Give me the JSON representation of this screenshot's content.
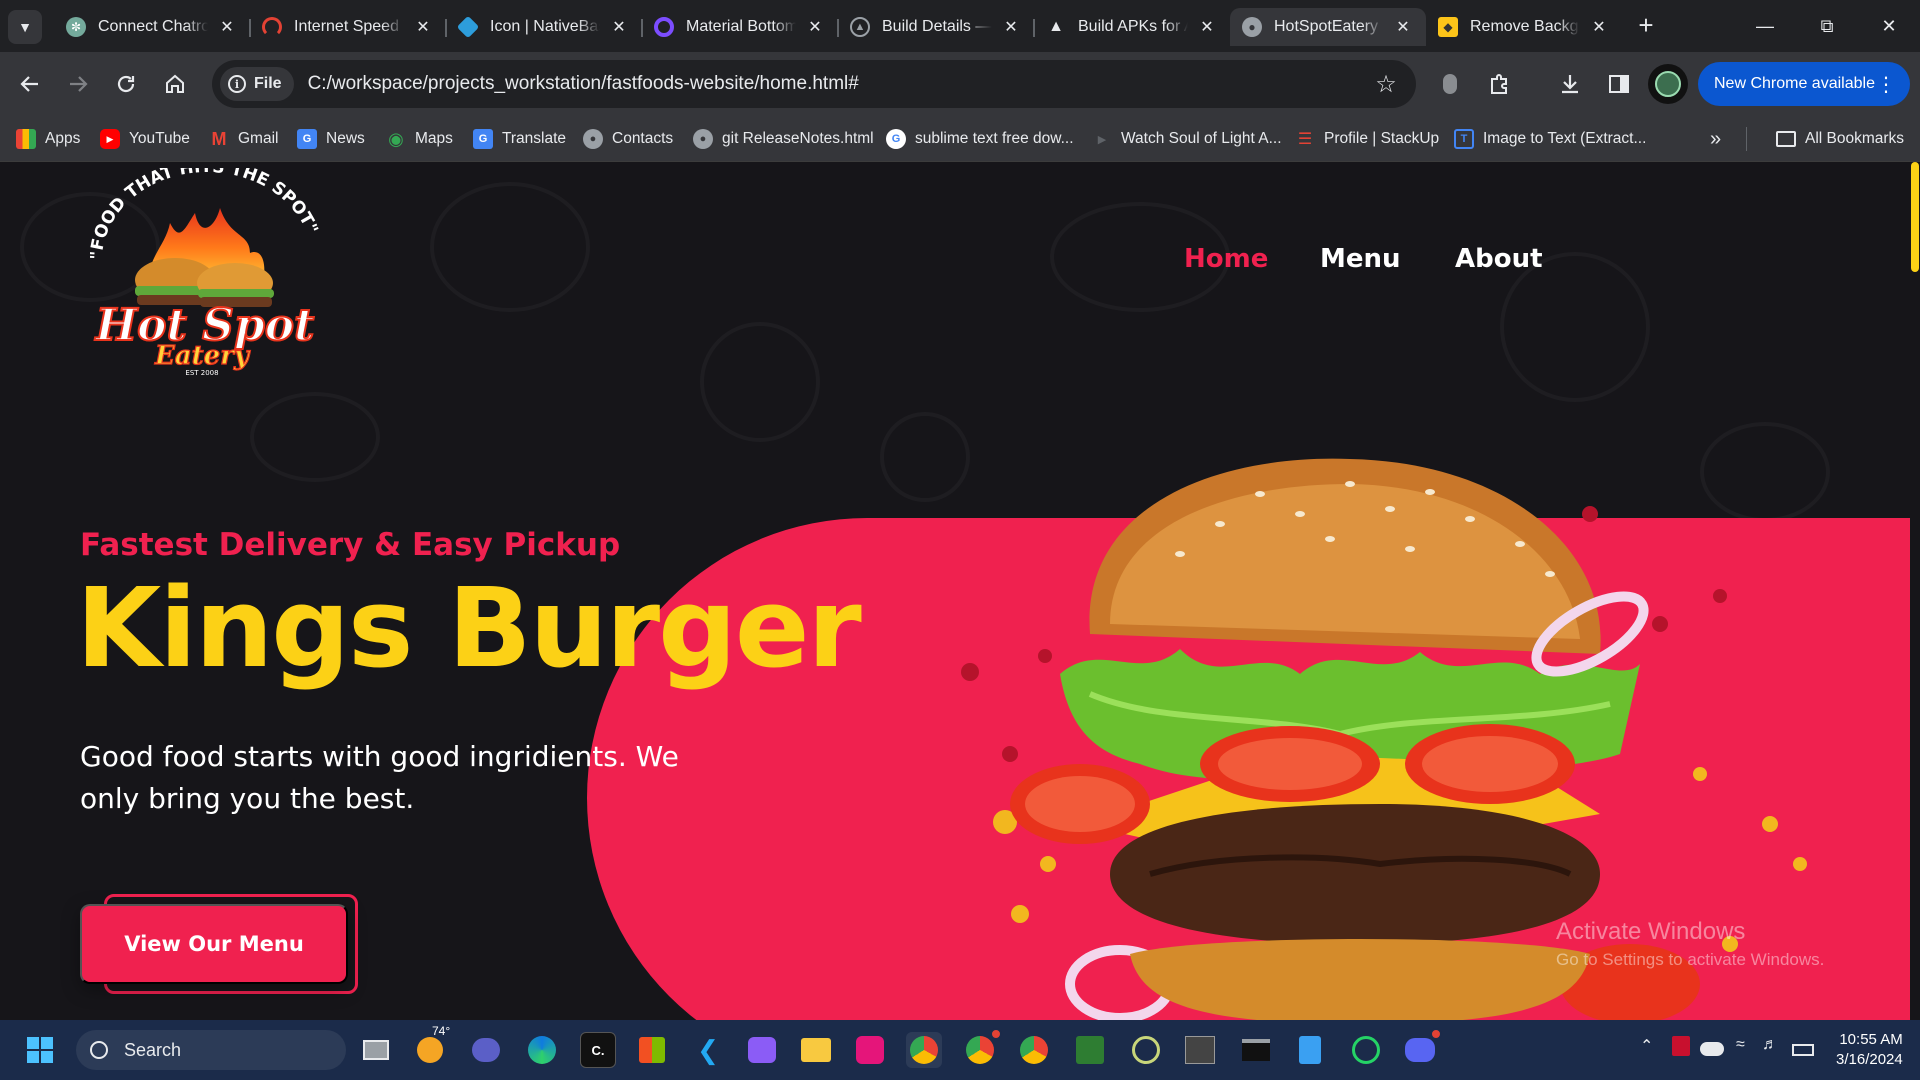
{
  "browser": {
    "tabs": [
      {
        "title": "Connect Chatroom",
        "icon": "chatgpt-icon",
        "color": "#74aa9c"
      },
      {
        "title": "Internet Speed Test",
        "icon": "speedtest-icon",
        "color": "#e34234"
      },
      {
        "title": "Icon | NativeBase",
        "icon": "nativebase-icon",
        "color": "#2d9ddb"
      },
      {
        "title": "Material Bottom Tabs",
        "icon": "material-icon",
        "color": "#7c4dff"
      },
      {
        "title": "Build Details — Expo",
        "icon": "expo-icon",
        "color": "#9aa0a6"
      },
      {
        "title": "Build APKs for Android",
        "icon": "expo-build-icon",
        "color": "#e8eaed"
      },
      {
        "title": "HotSpotEatery",
        "icon": "globe-icon",
        "color": "#9aa0a6",
        "active": true
      },
      {
        "title": "Remove Background",
        "icon": "remove-bg-icon",
        "color": "#fcc419"
      }
    ],
    "address_chip": "File",
    "url": "C:/workspace/projects_workstation/fastfoods-website/home.html#",
    "new_chrome_label": "New Chrome available",
    "bookmarks": [
      {
        "label": "Apps",
        "icon": "apps-grid-icon"
      },
      {
        "label": "YouTube",
        "icon": "youtube-icon"
      },
      {
        "label": "Gmail",
        "icon": "gmail-icon"
      },
      {
        "label": "News",
        "icon": "news-icon"
      },
      {
        "label": "Maps",
        "icon": "maps-icon"
      },
      {
        "label": "Translate",
        "icon": "translate-icon"
      },
      {
        "label": "Contacts",
        "icon": "globe-icon"
      },
      {
        "label": "git ReleaseNotes.html",
        "icon": "globe-icon"
      },
      {
        "label": "sublime text free dow...",
        "icon": "google-icon"
      },
      {
        "label": "Watch Soul of Light A...",
        "icon": "play-icon"
      },
      {
        "label": "Profile | StackUp",
        "icon": "stackup-icon"
      },
      {
        "label": "Image to Text (Extract...",
        "icon": "image-text-icon"
      }
    ],
    "all_bookmarks_label": "All Bookmarks"
  },
  "site": {
    "logo_alt": "Hot Spot Eatery",
    "logo_arc_text": "\"FOOD THAT HITS THE SPOT\"",
    "logo_line1": "Hot Spot",
    "logo_line2": "Eatery",
    "logo_est": "EST 2008",
    "nav": [
      {
        "label": "Home",
        "active": true
      },
      {
        "label": "Menu"
      },
      {
        "label": "About"
      }
    ],
    "tagline": "Fastest Delivery & Easy Pickup",
    "headline": "Kings Burger",
    "description": "Good food starts with good ingridients. We only bring you the best.",
    "cta_label": "View Our Menu",
    "accent_color": "#f0214f",
    "headline_color": "#fcd116",
    "background_color": "#161519"
  },
  "watermark": {
    "line1": "Activate Windows",
    "line2": "Go to Settings to activate Windows."
  },
  "taskbar": {
    "search_placeholder": "Search",
    "weather_temp": "74°",
    "time": "10:55 AM",
    "date": "3/16/2024"
  }
}
